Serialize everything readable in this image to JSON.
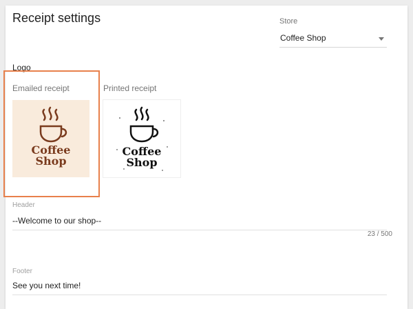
{
  "page": {
    "title": "Receipt settings"
  },
  "store": {
    "label": "Store",
    "value": "Coffee Shop"
  },
  "logo": {
    "heading": "Logo",
    "emailed_label": "Emailed receipt",
    "printed_label": "Printed receipt",
    "logo_text_line1": "Coffee",
    "logo_text_line2": "Shop",
    "emailed_color": "#7a3b1e",
    "emailed_bg": "#f9ebdc",
    "printed_color": "#111111"
  },
  "header_field": {
    "label": "Header",
    "value": "--Welcome to our shop--",
    "counter": "23 / 500"
  },
  "footer_field": {
    "label": "Footer",
    "value": "See you next time!"
  },
  "colors": {
    "highlight": "#e8804b"
  }
}
